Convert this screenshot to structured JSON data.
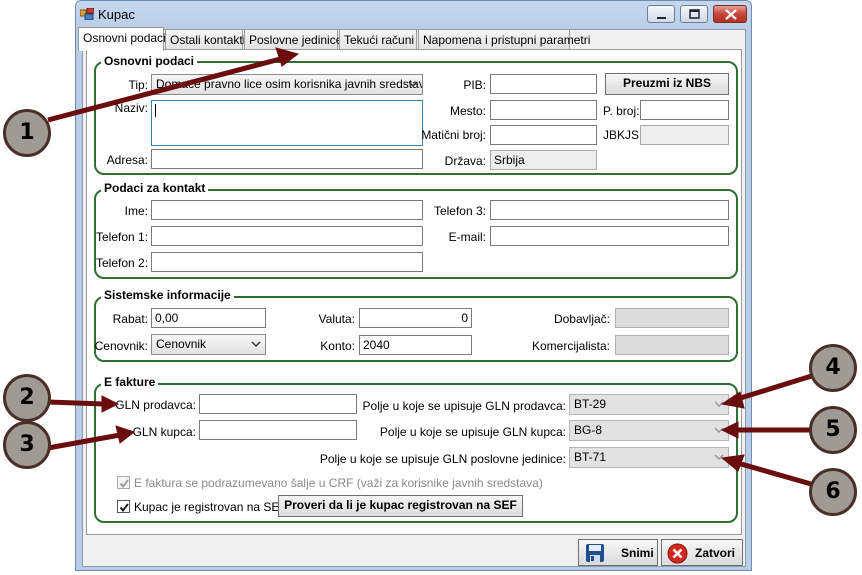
{
  "window": {
    "title": "Kupac"
  },
  "tabs": [
    "Osnovni podaci",
    "Ostali kontakti",
    "Poslovne jedinice",
    "Tekući računi",
    "Napomena i pristupni parametri"
  ],
  "osnovni": {
    "group_title": "Osnovni podaci",
    "tip_label": "Tip:",
    "tip_value": "Domaće pravno lice osim korisnika javnih sredstava",
    "naziv_label": "Naziv:",
    "naziv_value": "",
    "adresa_label": "Adresa:",
    "adresa_value": "",
    "pib_label": "PIB:",
    "pib_value": "",
    "preuzmi_button": "Preuzmi iz NBS",
    "mesto_label": "Mesto:",
    "mesto_value": "",
    "pbroj_label": "P. broj:",
    "pbroj_value": "",
    "maticni_label": "Matični broj:",
    "maticni_value": "",
    "jbkjs_label": "JBKJS:",
    "jbkjs_value": "",
    "drzava_label": "Država:",
    "drzava_value": "Srbija"
  },
  "kontakt": {
    "group_title": "Podaci za kontakt",
    "ime_label": "Ime:",
    "telefon1_label": "Telefon 1:",
    "telefon2_label": "Telefon 2:",
    "telefon3_label": "Telefon 3:",
    "email_label": "E-mail:"
  },
  "sistem": {
    "group_title": "Sistemske informacije",
    "rabat_label": "Rabat:",
    "rabat_value": "0,00",
    "cenovnik_label": "Cenovnik:",
    "cenovnik_value": "Cenovnik",
    "valuta_label": "Valuta:",
    "valuta_value": "0",
    "konto_label": "Konto:",
    "konto_value": "2040",
    "dobavljac_label": "Dobavljač:",
    "komercijalista_label": "Komercijalista:"
  },
  "efakture": {
    "group_title": "E fakture",
    "gln_prodavca_label": "GLN prodavca:",
    "gln_kupca_label": "GLN kupca:",
    "polje_prodavca_label": "Polje u koje se upisuje GLN prodavca:",
    "polje_prodavca_value": "BT-29",
    "polje_kupca_label": "Polje u koje se upisuje GLN kupca:",
    "polje_kupca_value": "BG-8",
    "polje_jedinice_label": "Polje u koje se upisuje GLN poslovne jedinice:",
    "polje_jedinice_value": "BT-71",
    "crf_label": "E faktura se podrazumevano šalje u CRF (važi za korisnike javnih sredstava)",
    "sef_label": "Kupac je registrovan na SEF",
    "proveri_button": "Proveri da li je kupac registrovan na SEF"
  },
  "footer": {
    "snimi": "Snimi",
    "zatvori": "Zatvori"
  },
  "markers": [
    "1",
    "2",
    "3",
    "4",
    "5",
    "6"
  ]
}
